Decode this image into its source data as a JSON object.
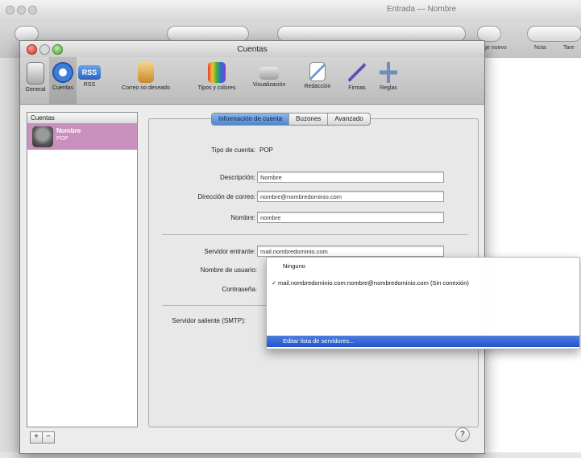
{
  "main_window": {
    "title": "Entrada — Nombre",
    "toolbar": {
      "nuevo_label": "ge nuevo",
      "nota_label": "Nota",
      "tareas_label": "Tare"
    }
  },
  "prefs": {
    "title": "Cuentas",
    "tabs": [
      {
        "label": "General",
        "icon": "switch-icon"
      },
      {
        "label": "Cuentas",
        "icon": "at-sign-icon"
      },
      {
        "label": "RSS",
        "icon": "rss-icon"
      },
      {
        "label": "Correo no deseado",
        "icon": "junk-mail-icon"
      },
      {
        "label": "Tipos y colores",
        "icon": "fonts-colors-icon"
      },
      {
        "label": "Visualización",
        "icon": "viewing-icon"
      },
      {
        "label": "Redacción",
        "icon": "composing-icon"
      },
      {
        "label": "Firmas",
        "icon": "signature-icon"
      },
      {
        "label": "Reglas",
        "icon": "rules-icon"
      }
    ],
    "accounts": {
      "header": "Cuentas",
      "selected": {
        "name": "Nombre",
        "type": "POP"
      },
      "add_label": "+",
      "remove_label": "−"
    },
    "account_tabs": [
      "Información de cuenta",
      "Buzones",
      "Avanzado"
    ],
    "form": {
      "tipo_label": "Tipo de cuenta:",
      "tipo_value": "POP",
      "descripcion_label": "Descripción:",
      "descripcion_value": "Nombre",
      "correo_label": "Dirección de correo:",
      "correo_value": "nombre@nombredominio.com",
      "nombre_label": "Nombre:",
      "nombre_value": "nombre",
      "servidor_entrante_label": "Servidor entrante:",
      "servidor_entrante_value": "mail.nombredominio.com",
      "usuario_label": "Nombre de usuario:",
      "contrasena_label": "Contraseña:",
      "smtp_label": "Servidor saliente (SMTP):"
    },
    "popup": {
      "items": [
        {
          "label": "Ninguno",
          "checked": ""
        },
        {
          "label": "mail.nombredominio.com:nombre@nombredominio.com (Sin conexión)",
          "checked": "✓"
        },
        {
          "label": "Editar lista de servidores...",
          "checked": ""
        }
      ]
    },
    "help_label": "?"
  },
  "colors": {
    "selection_pink": "#c98fbd",
    "menu_highlight": "#2254c8",
    "active_segment": "#4d86d2"
  }
}
